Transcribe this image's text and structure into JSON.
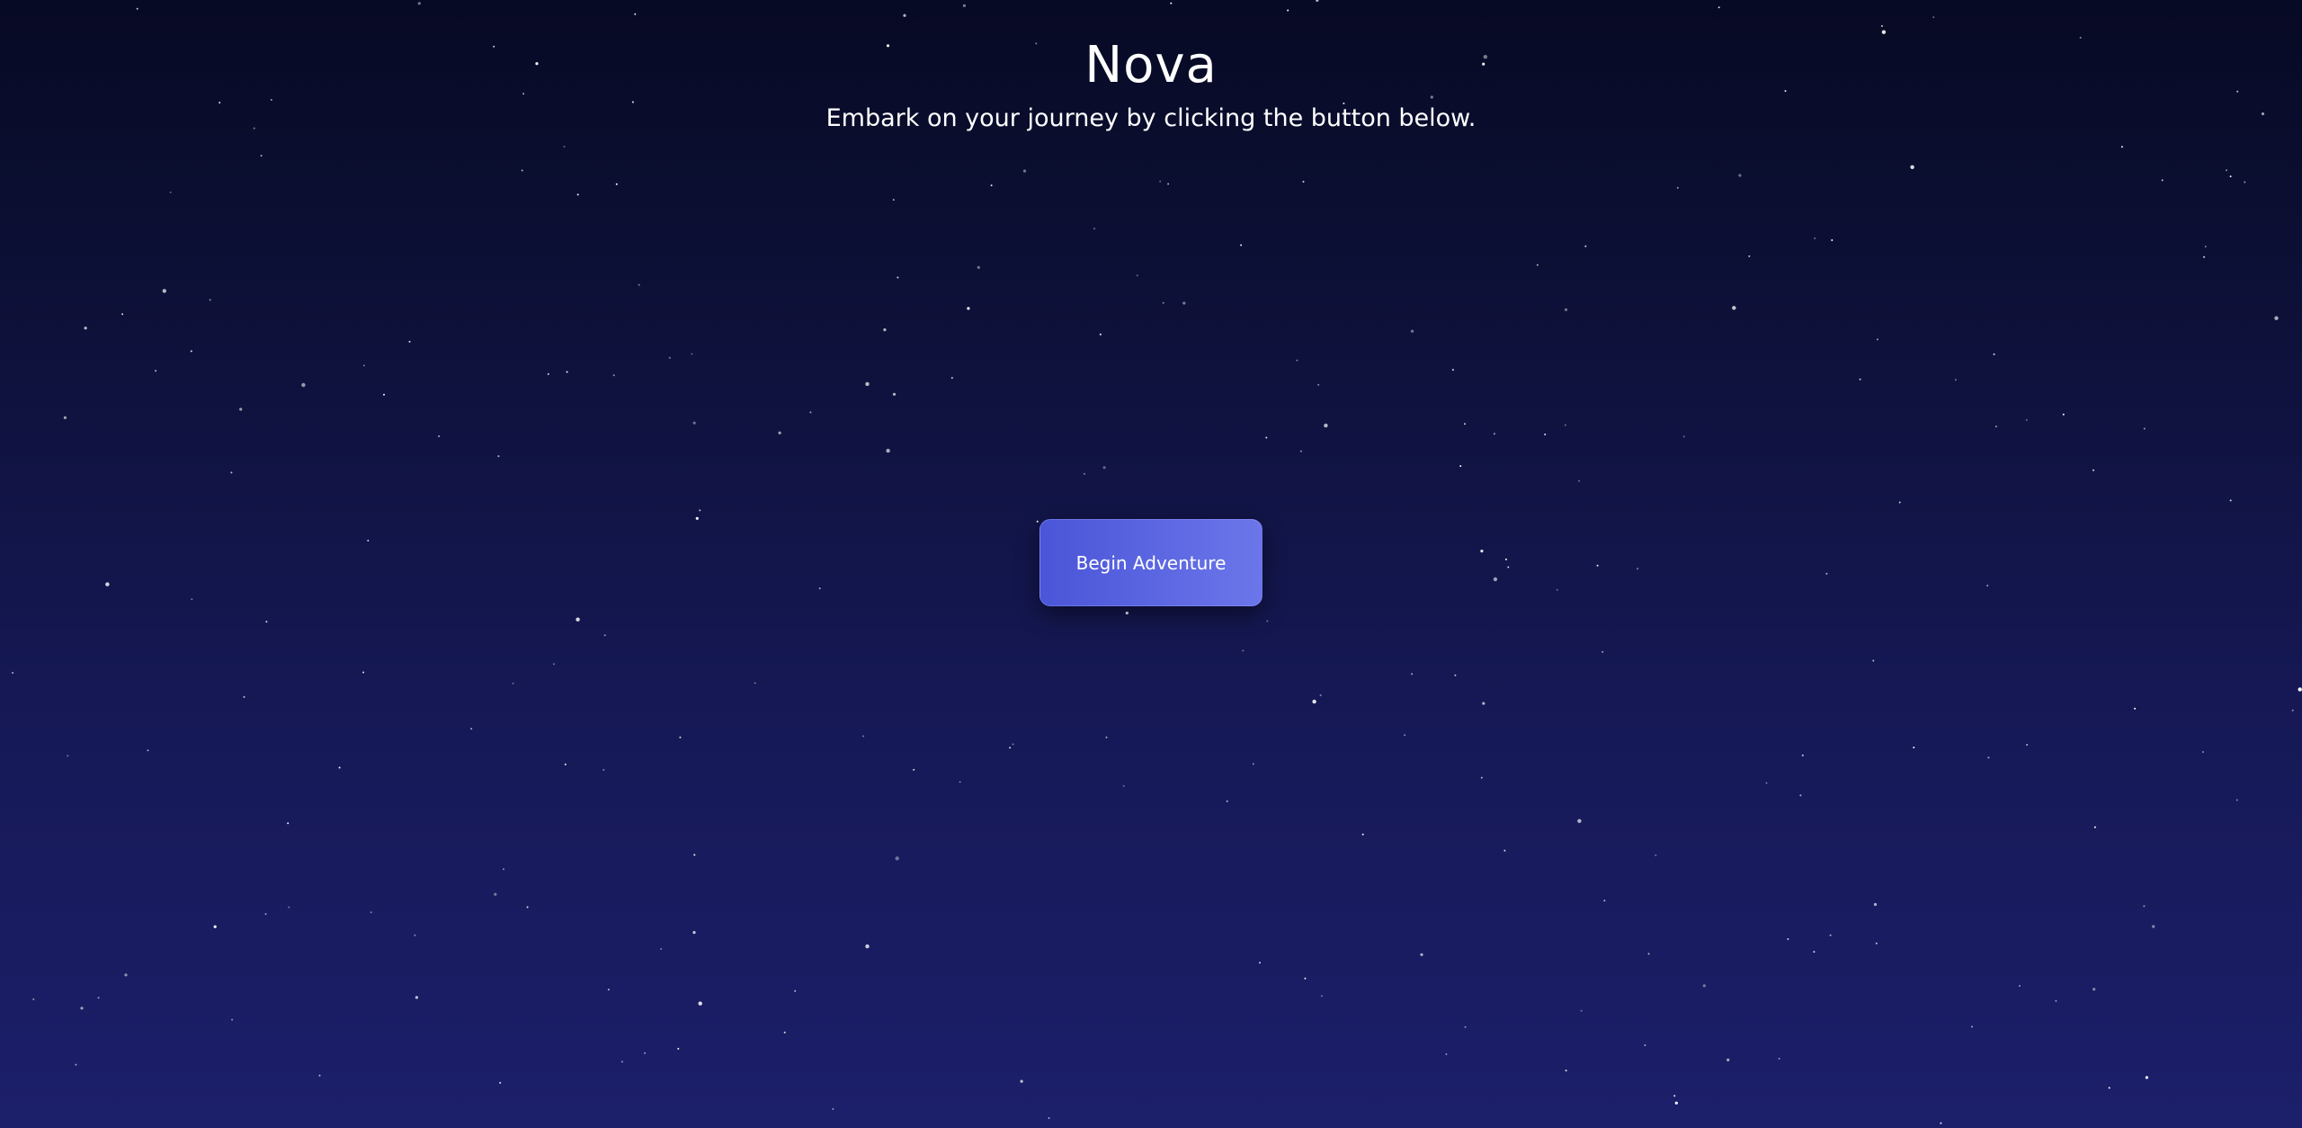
{
  "header": {
    "title": "Nova",
    "subtitle": "Embark on your journey by clicking the button below."
  },
  "main": {
    "cta_label": "Begin Adventure"
  },
  "colors": {
    "background_top": "#070a24",
    "background_bottom": "#1c1f6a",
    "button_gradient_start": "#4a55d8",
    "button_gradient_end": "#6c76ea",
    "text": "#ffffff",
    "star": "#ffffff"
  }
}
